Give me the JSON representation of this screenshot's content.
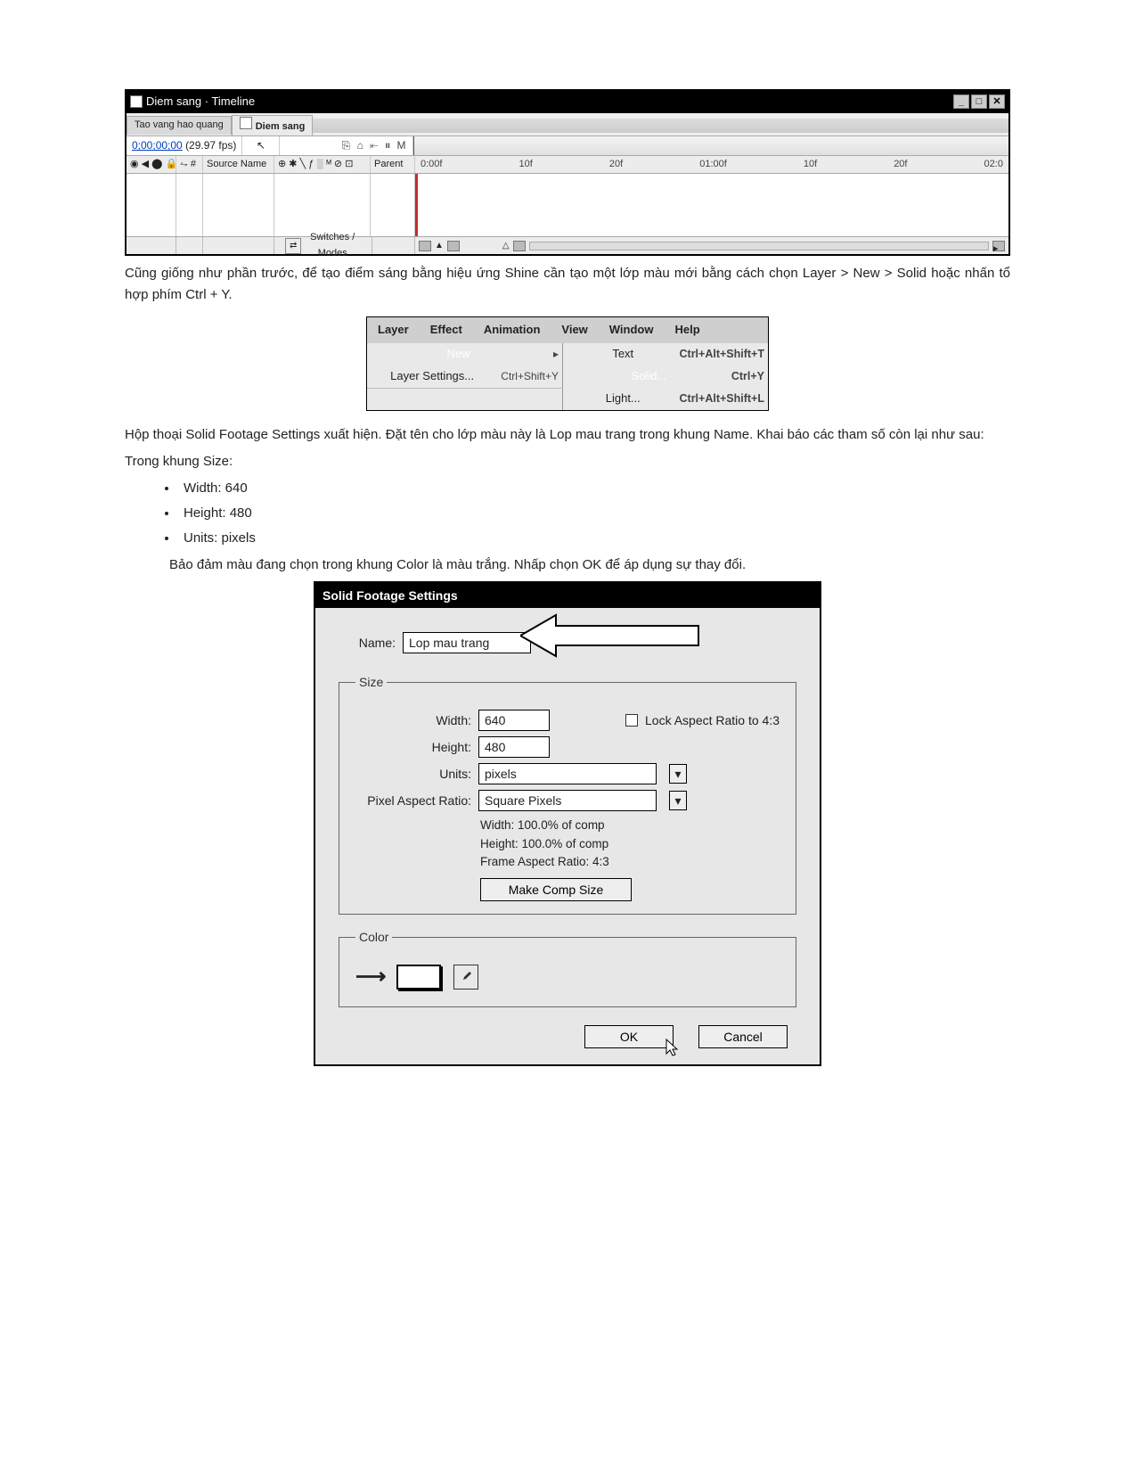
{
  "timeline": {
    "title": "Diem sang · Timeline",
    "tabs": [
      "Tao vang hao quang",
      "Diem sang"
    ],
    "timecode": "0;00;00;00",
    "fps": "(29.97 fps)",
    "header_icons": "⎘ ⌂  ⇤ ⏸ M",
    "columns": {
      "c1": "◉ ◀ ⬤ 🔒",
      "c2": "⥊ #",
      "c3": "Source Name",
      "c4": "⊕ ✱ ╲ ƒ ░ ᴹ ⊘ ⊡",
      "c5": "Parent"
    },
    "time_marks": [
      "0:00f",
      "10f",
      "20f",
      "01:00f",
      "10f",
      "20f",
      "02:0"
    ],
    "switches_modes": "Switches / Modes",
    "window_buttons": [
      "_",
      "□",
      "✕"
    ]
  },
  "para1": "Cũng giống như phần trước, để tạo điểm sáng bằng hiệu ứng Shine cần tạo một lớp màu mới bằng cách chọn Layer > New > Solid hoặc nhấn tổ hợp phím Ctrl + Y.",
  "menu": {
    "bar": [
      "Layer",
      "Effect",
      "Animation",
      "View",
      "Window",
      "Help"
    ],
    "left_items": [
      {
        "label": "New",
        "shortcut": "",
        "selected": true,
        "arrow": "▸"
      },
      {
        "label": "Layer Settings...",
        "shortcut": "Ctrl+Shift+Y"
      }
    ],
    "right_items": [
      {
        "label": "Text",
        "shortcut": "Ctrl+Alt+Shift+T"
      },
      {
        "label": "Solid...",
        "shortcut": "Ctrl+Y",
        "selected": true
      },
      {
        "label": "Light...",
        "shortcut": "Ctrl+Alt+Shift+L"
      }
    ]
  },
  "para2": "Hộp thoại Solid Footage Settings xuất hiện. Đặt tên cho lớp màu này là Lop mau trang trong khung Name. Khai báo các tham số còn lại như sau:",
  "trong_khung": "Trong khung Size:",
  "specs": [
    "Width: 640",
    "Height: 480",
    "Units: pixels"
  ],
  "para3": "Bảo đảm màu đang chọn trong khung Color là màu trắng. Nhấp chọn OK để áp dụng sự thay đổi.",
  "dlg": {
    "title": "Solid Footage Settings",
    "name_label": "Name:",
    "name_value": "Lop mau trang",
    "size_legend": "Size",
    "width_label": "Width:",
    "width_value": "640",
    "height_label": "Height:",
    "height_value": "480",
    "lock_label": "Lock Aspect Ratio to 4:3",
    "units_label": "Units:",
    "units_value": "pixels",
    "par_label": "Pixel Aspect Ratio:",
    "par_value": "Square Pixels",
    "info1": "Width:  100.0% of comp",
    "info2": "Height:  100.0% of comp",
    "info3": "Frame Aspect Ratio: 4:3",
    "make_comp": "Make Comp Size",
    "color_legend": "Color",
    "ok": "OK",
    "cancel": "Cancel"
  }
}
